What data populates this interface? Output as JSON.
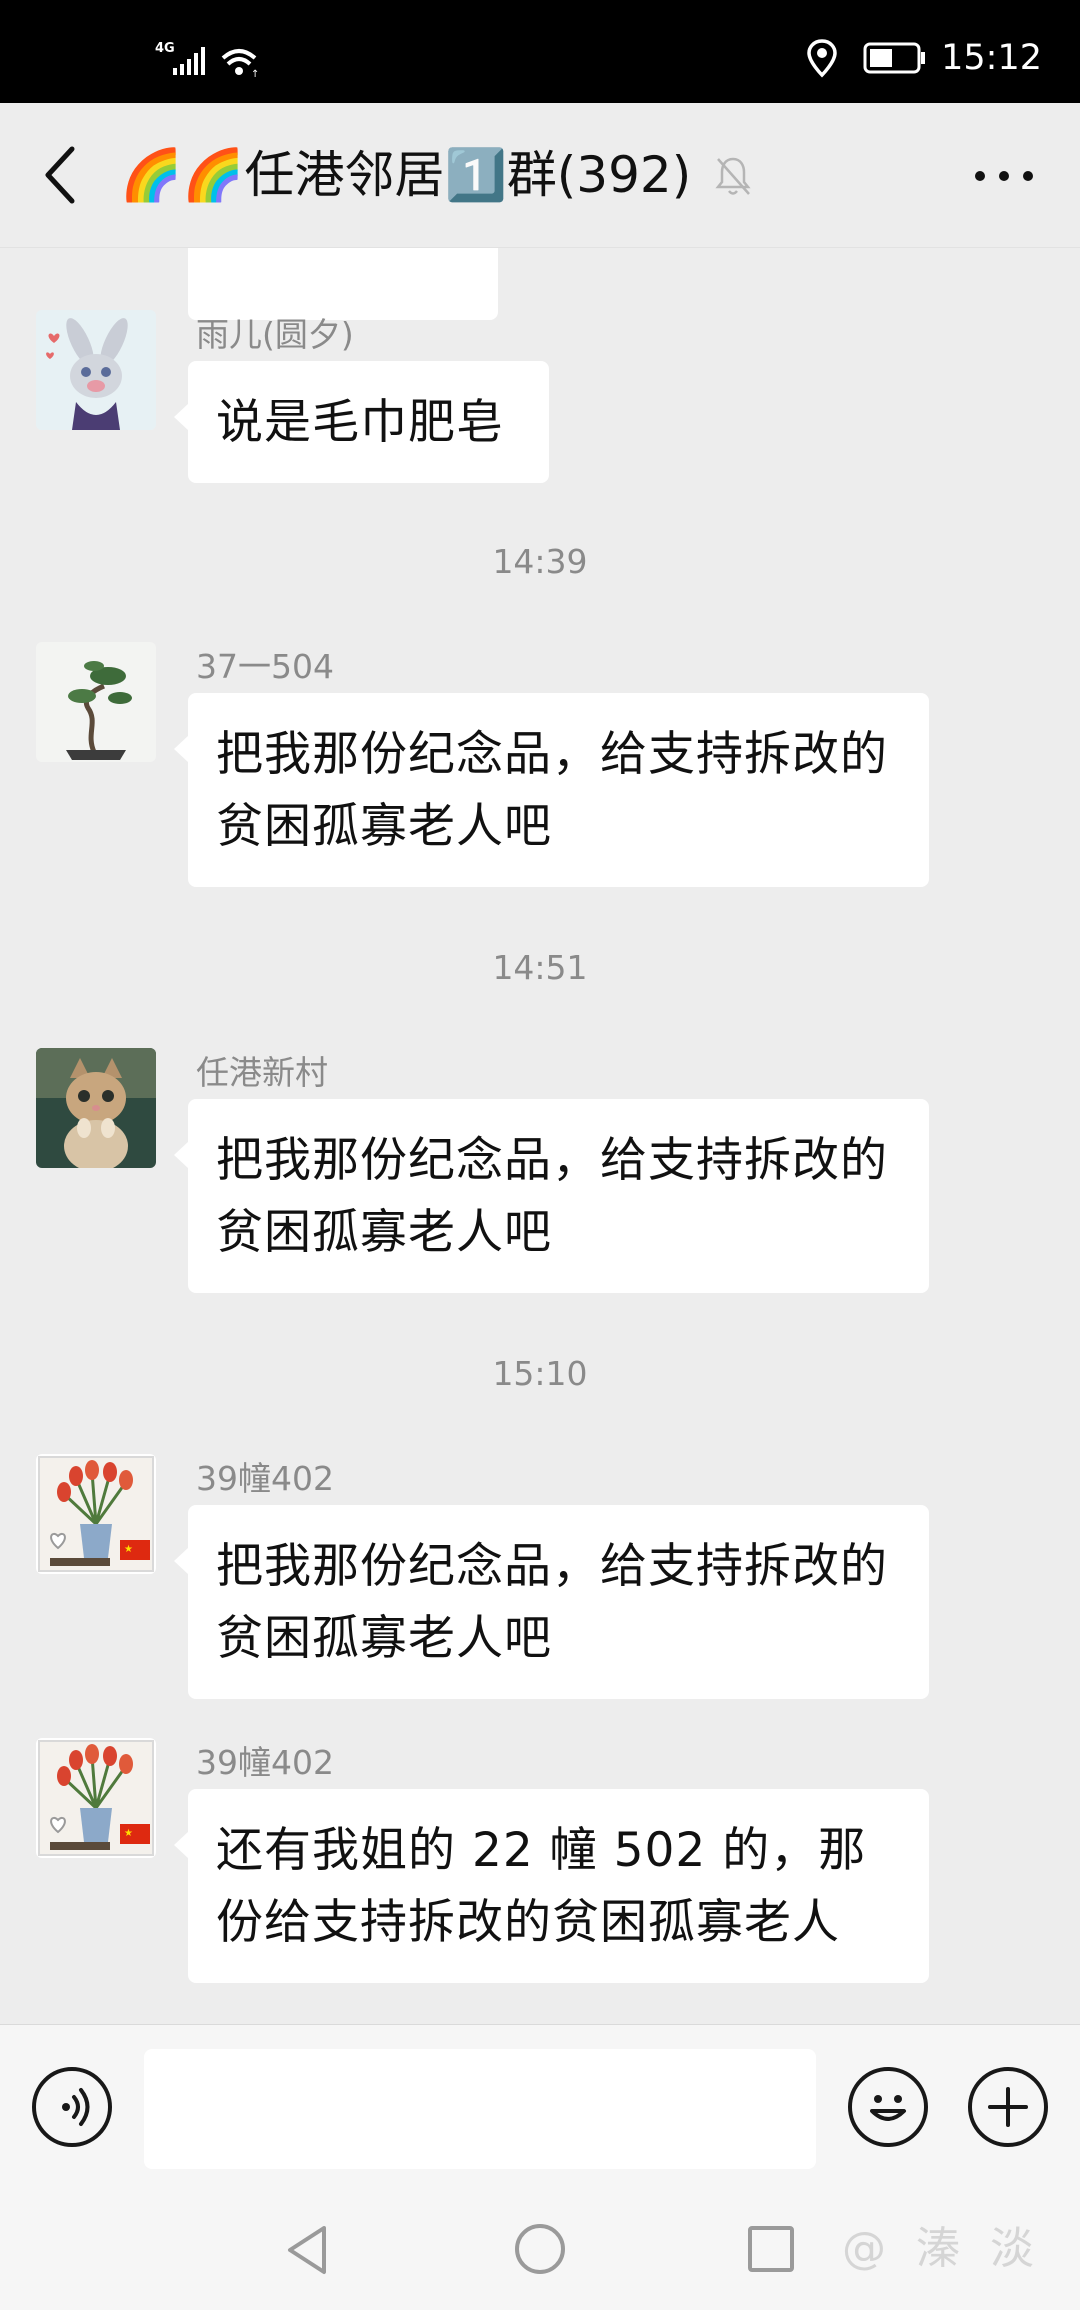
{
  "status_bar": {
    "network": "4G",
    "time": "15:12",
    "icons": [
      "signal-icon",
      "wifi-icon",
      "location-icon",
      "battery-icon"
    ]
  },
  "header": {
    "title": "🌈🌈任港邻居1️⃣群(392)",
    "muted": true,
    "icons": [
      "back-icon",
      "bell-off-icon",
      "more-icon"
    ]
  },
  "chat": {
    "messages": [
      {
        "type": "message",
        "sender": "",
        "text": ""
      },
      {
        "type": "message",
        "sender": "雨儿(圆夕)",
        "text": "说是毛巾肥皂"
      },
      {
        "type": "timestamp",
        "text": "14:39"
      },
      {
        "type": "message",
        "sender": "37一504",
        "text": "把我那份纪念品，给支持拆改的贫困孤寡老人吧"
      },
      {
        "type": "timestamp",
        "text": "14:51"
      },
      {
        "type": "message",
        "sender": "任港新村",
        "text": "把我那份纪念品，给支持拆改的贫困孤寡老人吧"
      },
      {
        "type": "timestamp",
        "text": "15:10"
      },
      {
        "type": "message",
        "sender": "39幢402",
        "text": "把我那份纪念品，给支持拆改的贫困孤寡老人吧"
      },
      {
        "type": "message",
        "sender": "39幢402",
        "text": "还有我姐的 22 幢 502 的，那份给支持拆改的贫困孤寡老人"
      }
    ]
  },
  "input_bar": {
    "value": "",
    "icons": [
      "voice-icon",
      "emoji-icon",
      "plus-icon"
    ]
  },
  "nav_bar": {
    "icons": [
      "nav-back-icon",
      "nav-home-icon",
      "nav-recents-icon"
    ],
    "watermark": "@ 溱 淡"
  },
  "colors": {
    "chat_background": "#EDEDED",
    "bubble": "#FFFFFF",
    "status_bar": "#000000",
    "secondary_text": "#8A8A8A"
  }
}
